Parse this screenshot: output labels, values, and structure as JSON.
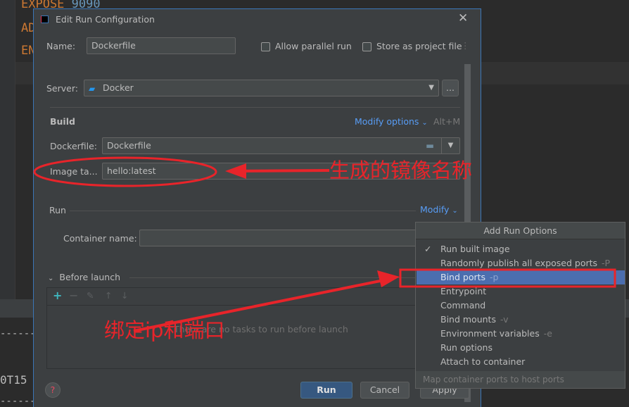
{
  "editor": {
    "lines": [
      {
        "keyword": "EXPOSE",
        "value": "9090"
      },
      {
        "keyword": "AD",
        "value": ""
      },
      {
        "keyword": "EN",
        "value": ""
      }
    ],
    "console_fragment": "0T15",
    "dashes": "------"
  },
  "dialog": {
    "title": "Edit Run Configuration",
    "name_label": "Name:",
    "name_value": "Dockerfile",
    "allow_parallel_label": "Allow parallel run",
    "allow_parallel_checked": false,
    "store_project_label": "Store as project file",
    "store_project_checked": false,
    "server_label": "Server:",
    "server_value": "Docker",
    "browse_label": "...",
    "build_heading": "Build",
    "modify_options_label": "Modify options",
    "modify_options_shortcut": "Alt+M",
    "dockerfile_label": "Dockerfile:",
    "dockerfile_value": "Dockerfile",
    "image_tag_label": "Image ta...",
    "image_tag_value": "hello:latest",
    "run_heading": "Run",
    "modify_label": "Modify",
    "container_name_label": "Container name:",
    "container_name_value": "",
    "before_launch_label": "Before launch",
    "before_launch_empty": "There are no tasks to run before launch",
    "run_button": "Run",
    "cancel_button": "Cancel",
    "apply_button": "Apply"
  },
  "popup": {
    "title": "Add Run Options",
    "items": [
      {
        "label": "Run built image",
        "shortcut": "",
        "checked": true,
        "selected": false
      },
      {
        "label": "Randomly publish all exposed ports",
        "shortcut": "-P",
        "checked": false,
        "selected": false
      },
      {
        "label": "Bind ports",
        "shortcut": "-p",
        "checked": false,
        "selected": true
      },
      {
        "label": "Entrypoint",
        "shortcut": "",
        "checked": false,
        "selected": false
      },
      {
        "label": "Command",
        "shortcut": "",
        "checked": false,
        "selected": false
      },
      {
        "label": "Bind mounts",
        "shortcut": "-v",
        "checked": false,
        "selected": false
      },
      {
        "label": "Environment variables",
        "shortcut": "-e",
        "checked": false,
        "selected": false
      },
      {
        "label": "Run options",
        "shortcut": "",
        "checked": false,
        "selected": false
      },
      {
        "label": "Attach to container",
        "shortcut": "",
        "checked": false,
        "selected": false
      }
    ],
    "footer": "Map container ports to host ports"
  },
  "annotations": {
    "image_name_note": "生成的镜像名称",
    "bind_note": "绑定ip和端口",
    "color": "#e8242a"
  },
  "colors": {
    "accent": "#589df6",
    "selection": "#4b6eaf",
    "dialog_bg": "#3c3f41",
    "editor_bg": "#2b2b2b"
  }
}
